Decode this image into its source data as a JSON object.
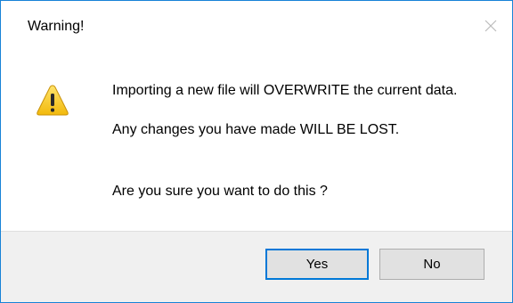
{
  "dialog": {
    "title": "Warning!",
    "close_icon": "close-icon",
    "warning_icon": "warning-icon",
    "messages": [
      "Importing a new file will OVERWRITE the current data.",
      "Any changes you have made WILL BE LOST.",
      "Are you sure you want to do this ?"
    ],
    "buttons": {
      "yes": "Yes",
      "no": "No"
    },
    "colors": {
      "border": "#1883d7",
      "footer": "#f0f0f0",
      "default_button_border": "#0078d7",
      "warning_yellow": "#f5c518"
    }
  }
}
